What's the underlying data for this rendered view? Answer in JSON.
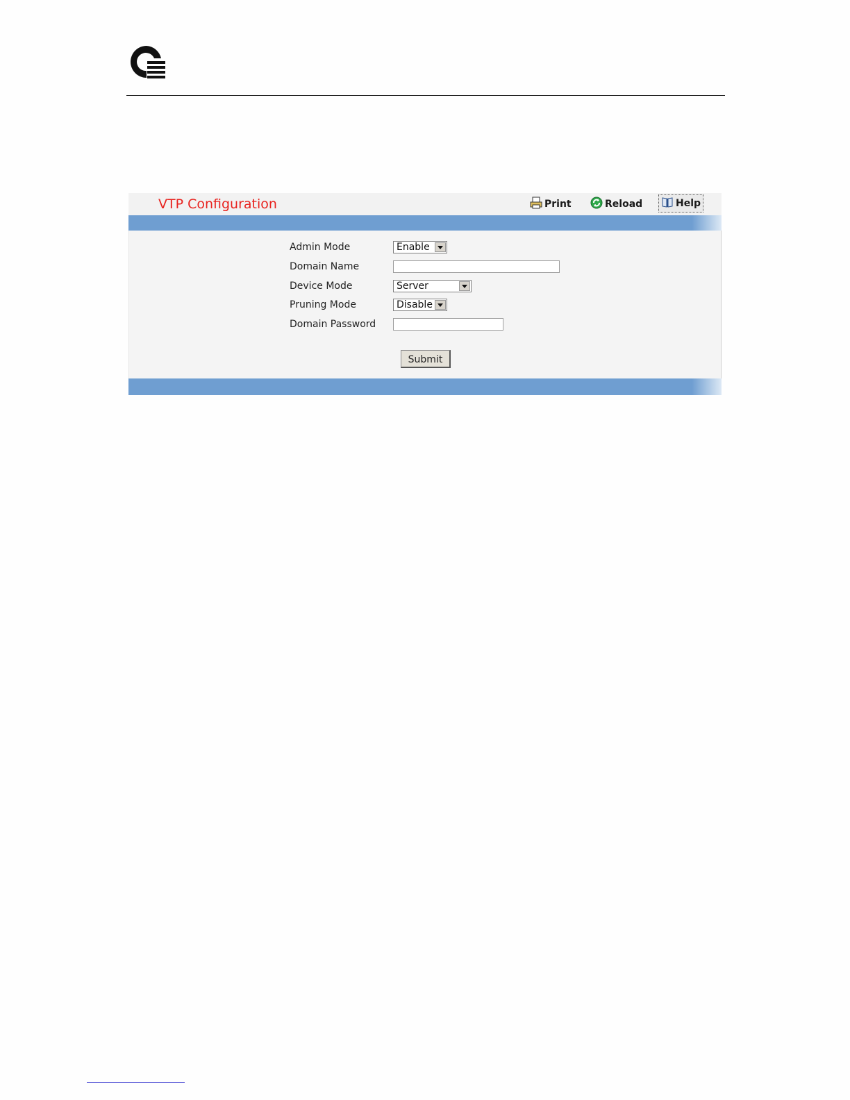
{
  "header": {
    "logo_icon": "q-logo-icon"
  },
  "panel": {
    "title": "VTP Configuration",
    "toolbar": {
      "print_label": "Print",
      "reload_label": "Reload",
      "help_label": "Help"
    },
    "form": {
      "admin_mode": {
        "label": "Admin Mode",
        "value": "Enable"
      },
      "domain_name": {
        "label": "Domain Name",
        "value": ""
      },
      "device_mode": {
        "label": "Device Mode",
        "value": "Server"
      },
      "pruning_mode": {
        "label": "Pruning Mode",
        "value": "Disable"
      },
      "domain_password": {
        "label": "Domain Password",
        "value": ""
      },
      "submit_label": "Submit"
    }
  },
  "colors": {
    "title": "#e8231f",
    "bar": "#6f9ed1",
    "panel_bg": "#f4f4f4"
  }
}
